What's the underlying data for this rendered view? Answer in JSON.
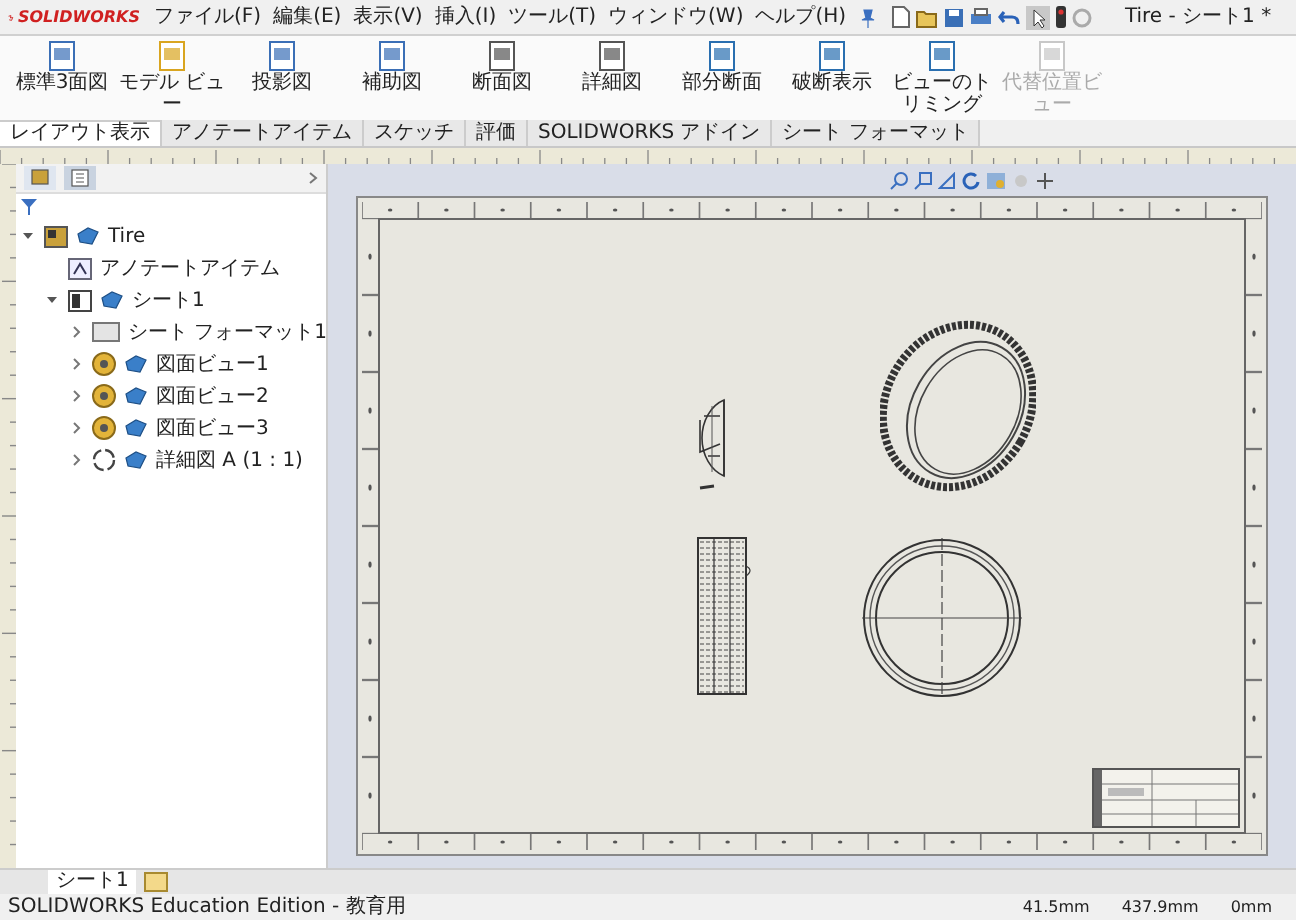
{
  "app": {
    "logo": "SOLIDWORKS",
    "title": "Tire - シート1 *"
  },
  "menu": [
    "ファイル(F)",
    "編集(E)",
    "表示(V)",
    "挿入(I)",
    "ツール(T)",
    "ウィンドウ(W)",
    "ヘルプ(H)"
  ],
  "ribbon": [
    {
      "label": "標準3面図",
      "kind": "views",
      "disabled": false
    },
    {
      "label": "モデル ビュー",
      "kind": "model",
      "disabled": false
    },
    {
      "label": "投影図",
      "kind": "projected",
      "disabled": false
    },
    {
      "label": "補助図",
      "kind": "auxiliary",
      "disabled": false
    },
    {
      "label": "断面図",
      "kind": "section",
      "disabled": false
    },
    {
      "label": "詳細図",
      "kind": "detail",
      "disabled": false
    },
    {
      "label": "部分断面",
      "kind": "broken",
      "disabled": false
    },
    {
      "label": "破断表示",
      "kind": "break",
      "disabled": false
    },
    {
      "label": "ビューのトリミング",
      "kind": "crop",
      "disabled": false
    },
    {
      "label": "代替位置ビュー",
      "kind": "alternate",
      "disabled": true
    }
  ],
  "command_tabs": [
    {
      "label": "レイアウト表示",
      "selected": true
    },
    {
      "label": "アノテートアイテム",
      "selected": false
    },
    {
      "label": "スケッチ",
      "selected": false
    },
    {
      "label": "評価",
      "selected": false
    },
    {
      "label": "SOLIDWORKS アドイン",
      "selected": false
    },
    {
      "label": "シート フォーマット",
      "selected": false
    }
  ],
  "tree": [
    {
      "label": "Tire",
      "kind": "drawing",
      "expanded": true,
      "children": [
        {
          "label": "アノテートアイテム",
          "kind": "annotations"
        },
        {
          "label": "シート1",
          "kind": "sheet",
          "expanded": true,
          "children": [
            {
              "label": "シート フォーマット1",
              "kind": "format",
              "expanded": false
            },
            {
              "label": "図面ビュー1",
              "kind": "view",
              "expanded": false
            },
            {
              "label": "図面ビュー2",
              "kind": "view",
              "expanded": false
            },
            {
              "label": "図面ビュー3",
              "kind": "view",
              "expanded": false
            },
            {
              "label": "詳細図 A (1 : 1)",
              "kind": "detail",
              "expanded": false
            }
          ]
        }
      ]
    }
  ],
  "sheet_tabs": [
    {
      "label": "シート1",
      "selected": true
    }
  ],
  "status_bar": {
    "text": "SOLIDWORKS Education Edition - 教育用",
    "readouts": [
      "41.5mm",
      "437.9mm",
      "0mm"
    ]
  }
}
